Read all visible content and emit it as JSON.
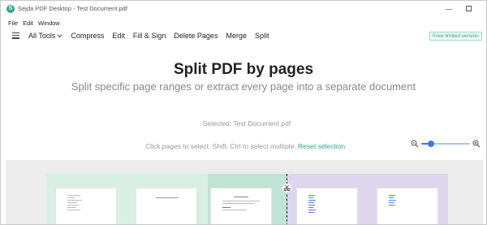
{
  "window": {
    "title": "Sejda PDF Desktop - Test Document.pdf",
    "logo_letter": "S",
    "minimize_glyph": "—"
  },
  "menu": [
    "File",
    "Edit",
    "Window"
  ],
  "nav": {
    "items": [
      "All Tools",
      "Compress",
      "Edit",
      "Fill & Sign",
      "Delete Pages",
      "Merge",
      "Split"
    ],
    "badge": "Free limited version"
  },
  "main": {
    "title": "Split PDF by pages",
    "subtitle": "Split specific page ranges or extract every page into a separate document",
    "selected_file": "Selected: Test Document.pdf",
    "hint": "Click pages to select. Shift, Ctrl to select multiple.",
    "reset_label": "Reset selection"
  },
  "zoom": {
    "level": 0.2
  },
  "colors": {
    "accent": "#2aa889",
    "zoom": "#3a7be0",
    "group_green": "#d9efe6",
    "group_purple": "#ddd6ee"
  }
}
